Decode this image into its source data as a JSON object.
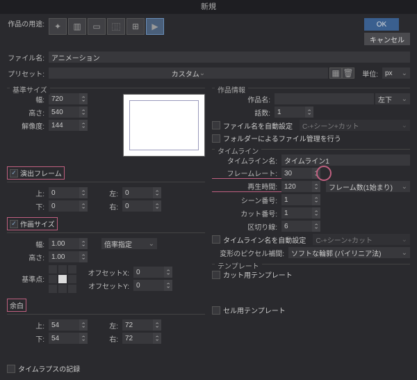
{
  "title": "新規",
  "buttons": {
    "ok": "OK",
    "cancel": "キャンセル"
  },
  "usage_label": "作品の用途:",
  "filename_label": "ファイル名:",
  "filename": "アニメーション",
  "preset_label": "プリセット:",
  "preset_value": "カスタム",
  "unit_label": "単位:",
  "unit_value": "px",
  "base_size": {
    "group": "基準サイズ",
    "width_lbl": "幅:",
    "width": "720",
    "height_lbl": "高さ:",
    "height": "540",
    "res_lbl": "解像度:",
    "res": "144"
  },
  "overflow": {
    "chk": "演出フレーム",
    "top_lbl": "上:",
    "top": "0",
    "bottom_lbl": "下:",
    "0": "0",
    "left_lbl": "左:",
    "left": "0",
    "right_lbl": "右:",
    "right": "0"
  },
  "canvas": {
    "chk": "作画サイズ",
    "width_lbl": "幅:",
    "width": "1.00",
    "height_lbl": "高さ:",
    "height": "1.00",
    "ratio": "倍率指定",
    "anchor_lbl": "基準点:",
    "ox_lbl": "オフセットX:",
    "ox": "0",
    "oy_lbl": "オフセットY:",
    "oy": "0"
  },
  "margin": {
    "group": "余白",
    "top_lbl": "上:",
    "top": "54",
    "bottom_lbl": "下:",
    "bottom": "54",
    "left_lbl": "左:",
    "left": "72",
    "right_lbl": "右:",
    "right": "72"
  },
  "info": {
    "group": "作品情報",
    "name_lbl": "作品名:",
    "name": "",
    "pos": "左下",
    "ep_lbl": "話数:",
    "ep": "1",
    "auto_file": "ファイル名を自動設定",
    "auto_file_val": "C-+シーン+カット",
    "folder_mgmt": "フォルダーによるファイル管理を行う"
  },
  "timeline": {
    "group": "タイムライン",
    "name_lbl": "タイムライン名:",
    "name": "タイムライン1",
    "fps_lbl": "フレームレート:",
    "fps": "30",
    "play_lbl": "再生時間:",
    "play": "120",
    "play_unit": "フレーム数(1始まり)",
    "scene_lbl": "シーン番号:",
    "scene": "1",
    "cut_lbl": "カット番号:",
    "cut": "1",
    "div_lbl": "区切り線:",
    "div": "6",
    "auto_tl": "タイムライン名を自動設定",
    "auto_tl_val": "C-+シーン+カット",
    "interp_lbl": "変形のピクセル補間:",
    "interp": "ソフトな輪郭 (バイリニア法)"
  },
  "template": {
    "group": "テンプレート",
    "cut": "カット用テンプレート",
    "cel": "セル用テンプレート"
  },
  "timelapse": "タイムラプスの記録"
}
